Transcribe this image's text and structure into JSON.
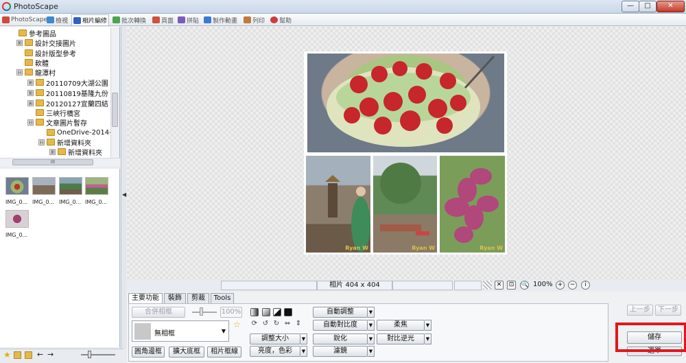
{
  "window": {
    "title": "PhotoScape",
    "min": "—",
    "max": "□",
    "close": "✕"
  },
  "tabs": [
    {
      "label": "PhotoScape",
      "color": "#d04a3a"
    },
    {
      "label": "檢視",
      "color": "#3a8ad0"
    },
    {
      "label": "相片編修",
      "color": "#2f62c4"
    },
    {
      "label": "批次轉換",
      "color": "#4aa54e"
    },
    {
      "label": "頁面",
      "color": "#d0503a"
    },
    {
      "label": "拼貼",
      "color": "#7a5ac0"
    },
    {
      "label": "製作動畫",
      "color": "#3a7ad0"
    },
    {
      "label": "列印",
      "color": "#c07a3a"
    },
    {
      "label": "幫助",
      "color": "#d03a3a"
    }
  ],
  "tree": [
    {
      "label": "參考圖品",
      "exp": ""
    },
    {
      "label": "設計交接圖片",
      "exp": "⊞"
    },
    {
      "label": "設計版型參考",
      "exp": ""
    },
    {
      "label": "軟體",
      "exp": ""
    },
    {
      "label": "龍潭村",
      "exp": "⊟"
    },
    {
      "label": "20110709大湖公園",
      "exp": "⊞"
    },
    {
      "label": "20110819基隆九份",
      "exp": "⊞"
    },
    {
      "label": "20120127宜蘭四結",
      "exp": "⊞"
    },
    {
      "label": "三峽行橋宮",
      "exp": ""
    },
    {
      "label": "文章圖片暫存",
      "exp": "⊟"
    },
    {
      "label": "OneDrive-2014-",
      "exp": ""
    },
    {
      "label": "新增資料夾",
      "exp": "⊟"
    },
    {
      "label": "新增資料夾",
      "exp": "⊞"
    }
  ],
  "hscroll": "III",
  "thumbnails": [
    {
      "caption": "IMG_0..."
    },
    {
      "caption": "IMG_0..."
    },
    {
      "caption": "IMG_0..."
    },
    {
      "caption": "IMG_0..."
    },
    {
      "caption": "IMG_0..."
    }
  ],
  "watermark": "Ryan W",
  "status": {
    "info": "相片 404 x 404",
    "zoom": "100%"
  },
  "panel": {
    "tabs": [
      "主要功能",
      "裝飾",
      "剪裁",
      "Tools"
    ],
    "merge_frame": "合併相框",
    "frame_percent": "100%",
    "frame_combo": "無相框",
    "round_frame": "圓角邊框",
    "enlarge_frame": "擴大底框",
    "photo_frame": "相片框線",
    "auto_adjust": "自動調整",
    "auto_contrast": "自動對比度",
    "resize": "調整大小",
    "sharpen": "銳化",
    "brightness_color": "亮度，色彩",
    "filter": "濾鏡",
    "soft_focus": "柔焦",
    "backlight": "對比逆光",
    "undo": "上一步",
    "redo": "下一步",
    "save": "儲存",
    "menu": "選單"
  }
}
